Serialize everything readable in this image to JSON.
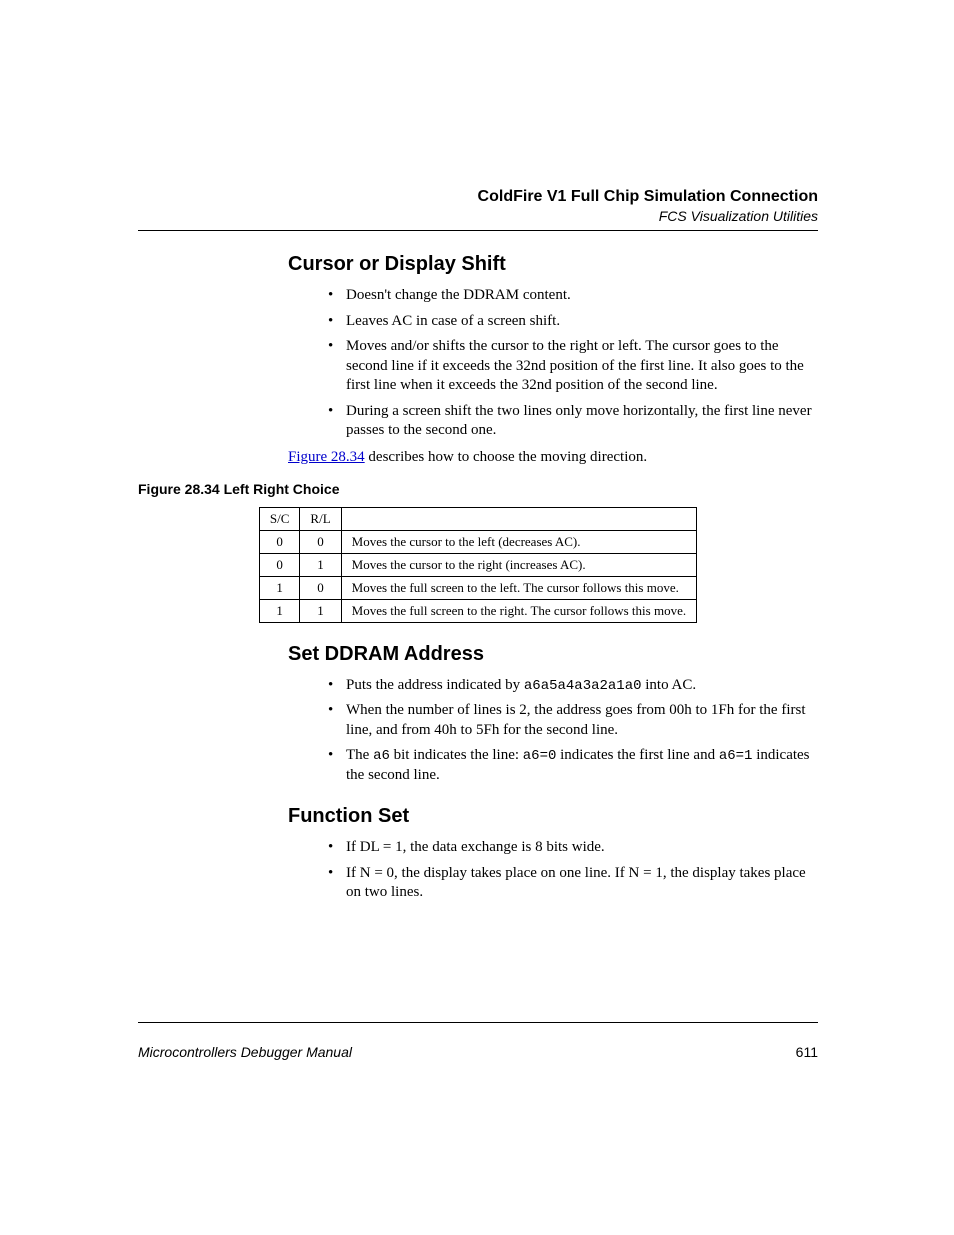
{
  "header": {
    "chapter": "ColdFire V1 Full Chip Simulation Connection",
    "section": "FCS Visualization Utilities"
  },
  "sections": {
    "cursor": {
      "title": "Cursor or Display Shift",
      "bullets": [
        "Doesn't change the DDRAM content.",
        "Leaves AC in case of a screen shift.",
        "Moves and/or shifts the cursor to the right or left. The cursor goes to the second line if it exceeds the 32nd position of the first line. It also goes to the first line when it exceeds the 32nd position of the second line.",
        "During a screen shift the two lines only move horizontally, the first line never passes to the second one."
      ],
      "para_link": "Figure 28.34",
      "para_after": " describes how to choose the moving direction."
    },
    "figure": {
      "caption": "Figure 28.34  Left Right Choice",
      "headers": [
        "S/C",
        "R/L",
        ""
      ],
      "rows": [
        {
          "sc": "0",
          "rl": "0",
          "desc": "Moves the cursor to the left (decreases AC)."
        },
        {
          "sc": "0",
          "rl": "1",
          "desc": "Moves the cursor to the right (increases AC)."
        },
        {
          "sc": "1",
          "rl": "0",
          "desc": "Moves the full screen to the left. The cursor follows this move."
        },
        {
          "sc": "1",
          "rl": "1",
          "desc": "Moves the full screen to the right. The cursor follows this move."
        }
      ]
    },
    "ddram": {
      "title": "Set DDRAM Address",
      "b1_pre": "Puts the address indicated by ",
      "b1_code": "a6a5a4a3a2a1a0",
      "b1_post": " into AC.",
      "b2": "When the number of lines is 2, the address goes from 00h to 1Fh for the first line, and from 40h to 5Fh for the second line.",
      "b3_p1": "The ",
      "b3_c1": "a6",
      "b3_p2": " bit indicates the line: ",
      "b3_c2": "a6=0",
      "b3_p3": " indicates the first line and ",
      "b3_c3": "a6=1",
      "b3_p4": " indicates the second line."
    },
    "funcset": {
      "title": "Function Set",
      "bullets": [
        "If DL = 1, the data exchange is 8 bits wide.",
        "If N = 0, the display takes place on one line. If N = 1, the display takes place on two lines."
      ]
    }
  },
  "footer": {
    "title": "Microcontrollers Debugger Manual",
    "page": "611"
  }
}
